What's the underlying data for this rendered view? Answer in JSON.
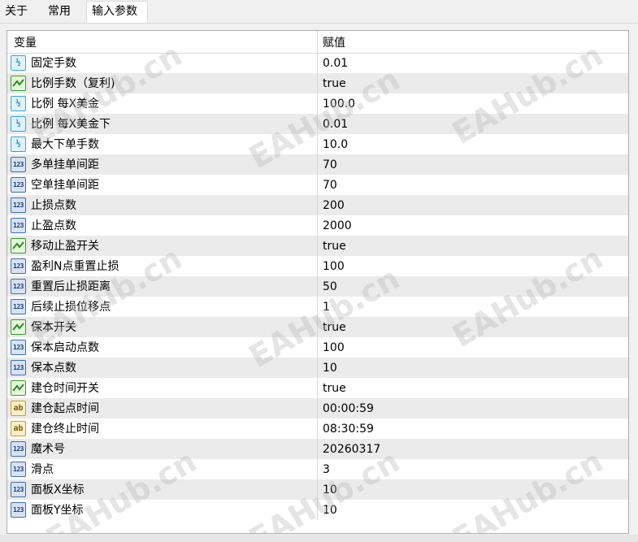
{
  "tabs": [
    {
      "label": "关于"
    },
    {
      "label": "常用"
    },
    {
      "label": "输入参数"
    }
  ],
  "table": {
    "headers": {
      "variable": "变量",
      "value": "赋值"
    },
    "rows": [
      {
        "icon": "double-icon",
        "name": "固定手数",
        "value": "0.01"
      },
      {
        "icon": "bool-icon",
        "name": "比例手数（复利)",
        "value": "true"
      },
      {
        "icon": "double-icon",
        "name": "比例 每X美金",
        "value": "100.0"
      },
      {
        "icon": "double-icon",
        "name": "比例 每X美金下",
        "value": "0.01"
      },
      {
        "icon": "double-icon",
        "name": "最大下单手数",
        "value": "10.0"
      },
      {
        "icon": "int-icon",
        "name": "多单挂单间距",
        "value": "70"
      },
      {
        "icon": "int-icon",
        "name": "空单挂单间距",
        "value": "70"
      },
      {
        "icon": "int-icon",
        "name": "止损点数",
        "value": "200"
      },
      {
        "icon": "int-icon",
        "name": "止盈点数",
        "value": "2000"
      },
      {
        "icon": "bool-icon",
        "name": "移动止盈开关",
        "value": "true"
      },
      {
        "icon": "int-icon",
        "name": "盈利N点重置止损",
        "value": "100"
      },
      {
        "icon": "int-icon",
        "name": "重置后止损距离",
        "value": "50"
      },
      {
        "icon": "int-icon",
        "name": "后续止损位移点",
        "value": "1"
      },
      {
        "icon": "bool-icon",
        "name": "保本开关",
        "value": "true"
      },
      {
        "icon": "int-icon",
        "name": "保本启动点数",
        "value": "100"
      },
      {
        "icon": "int-icon",
        "name": "保本点数",
        "value": "10"
      },
      {
        "icon": "bool-icon",
        "name": "建仓时间开关",
        "value": "true"
      },
      {
        "icon": "string-icon",
        "name": "建仓起点时间",
        "value": "00:00:59"
      },
      {
        "icon": "string-icon",
        "name": "建仓终止时间",
        "value": "08:30:59"
      },
      {
        "icon": "int-icon",
        "name": "魔术号",
        "value": "20260317"
      },
      {
        "icon": "int-icon",
        "name": "滑点",
        "value": "3"
      },
      {
        "icon": "int-icon",
        "name": "面板X坐标",
        "value": "10"
      },
      {
        "icon": "int-icon",
        "name": "面板Y坐标",
        "value": "10"
      }
    ]
  },
  "icon_glyphs": {
    "double": "½",
    "int": "123",
    "string": "ab"
  },
  "watermark": "EAHub.cn",
  "colors": {
    "row_alt": "#ebebeb",
    "selected_tab": "#ffffff"
  }
}
